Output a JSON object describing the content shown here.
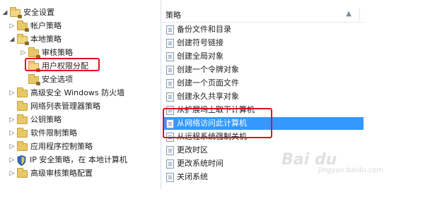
{
  "tree": {
    "items": [
      {
        "label": "安全设置",
        "expander": "◢",
        "icon": "folder-lock-icon"
      },
      {
        "label": "帐户策略",
        "expander": "▷",
        "icon": "folder-lock-icon"
      },
      {
        "label": "本地策略",
        "expander": "◢",
        "icon": "folder-lock-icon"
      },
      {
        "label": "审核策略",
        "expander": "▷",
        "icon": "folder-lock-icon"
      },
      {
        "label": "用户权限分配",
        "expander": "",
        "icon": "folder-lock-icon"
      },
      {
        "label": "安全选项",
        "expander": "",
        "icon": "folder-lock-icon"
      },
      {
        "label": "高级安全 Windows 防火墙",
        "expander": "▷",
        "icon": "folder-icon"
      },
      {
        "label": "网络列表管理器策略",
        "expander": "",
        "icon": "folder-icon"
      },
      {
        "label": "公钥策略",
        "expander": "▷",
        "icon": "folder-icon"
      },
      {
        "label": "软件限制策略",
        "expander": "▷",
        "icon": "folder-icon"
      },
      {
        "label": "应用程序控制策略",
        "expander": "▷",
        "icon": "folder-icon"
      },
      {
        "label": "IP 安全策略，在 本地计算机",
        "expander": "▷",
        "icon": "shield-icon"
      },
      {
        "label": "高级审核策略配置",
        "expander": "▷",
        "icon": "folder-icon"
      }
    ]
  },
  "policy_pane": {
    "header": "策略",
    "sort_arrow": "▲",
    "items": [
      "备份文件和目录",
      "创建符号链接",
      "创建全局对象",
      "创建一个令牌对象",
      "创建一个页面文件",
      "创建永久共享对象",
      "从扩展坞上取下计算机",
      "从网络访问此计算机",
      "从远程系统强制关机",
      "更改时区",
      "更改系统时间",
      "关闭系统"
    ],
    "selected_index": 7
  },
  "watermark": {
    "text": "Bai du",
    "subtext": "jingyan.baidu.com"
  },
  "colors": {
    "selection": "#3399ff",
    "highlight_box": "#e3101a"
  }
}
